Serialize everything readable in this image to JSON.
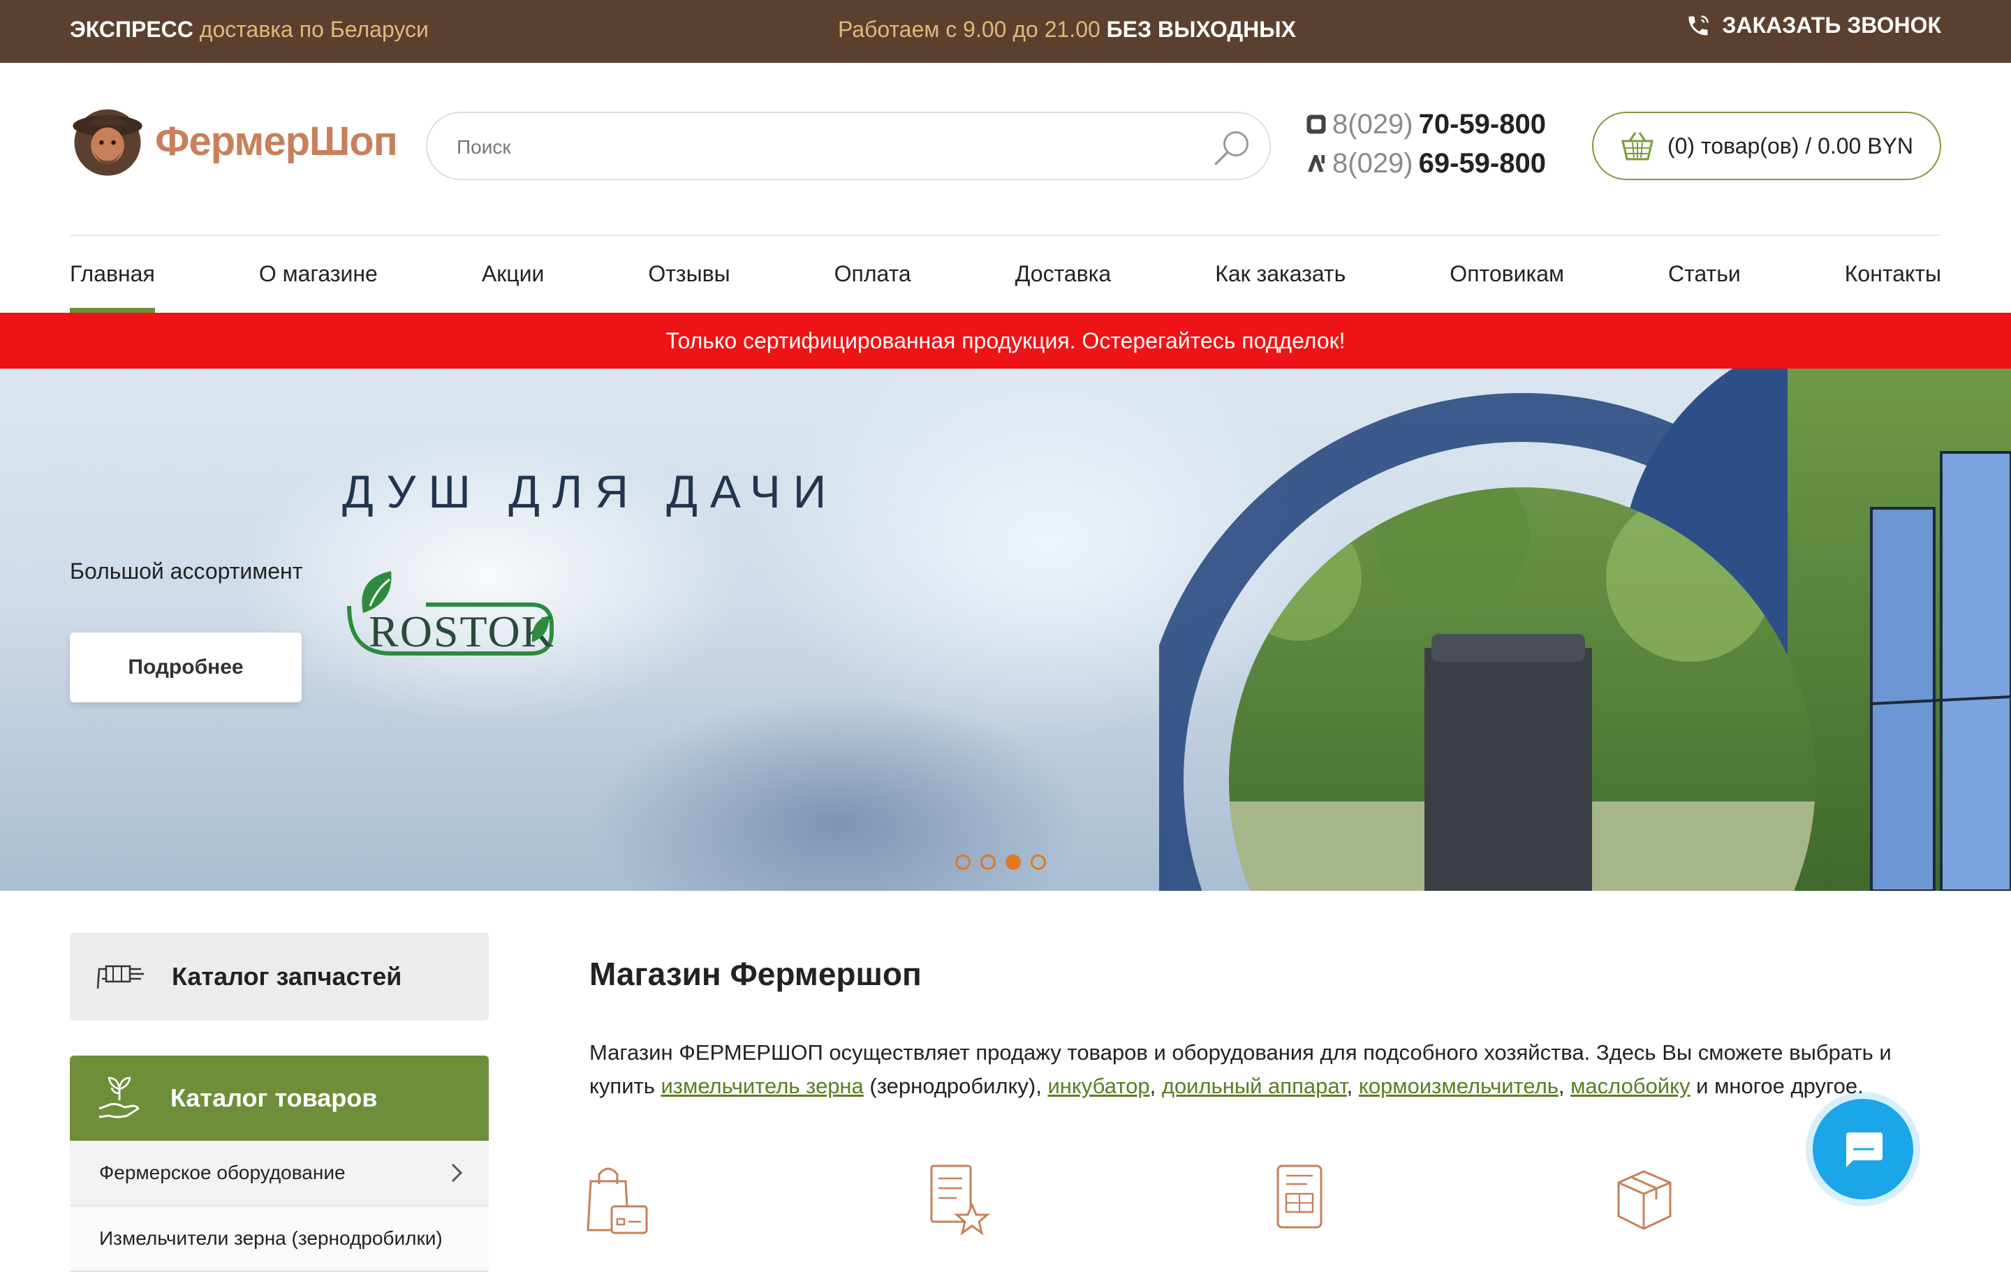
{
  "topbar": {
    "express_bold": "ЭКСПРЕСС",
    "express_rest": " доставка по Беларуси",
    "hours_text": "Работаем с 9.00 до 21.00 ",
    "hours_bold": "БЕЗ ВЫХОДНЫХ",
    "callback_label": "ЗАКАЗАТЬ ЗВОНОК"
  },
  "header": {
    "logo_text": "ФермерШоп",
    "search_placeholder": "Поиск",
    "phones": [
      {
        "code": "8(029)",
        "number": "70-59-800",
        "operator_icon": "a1-icon"
      },
      {
        "code": "8(029)",
        "number": "69-59-800",
        "operator_icon": "a1-alt-icon"
      }
    ],
    "cart_label": "(0) товар(ов) / 0.00 BYN"
  },
  "nav": {
    "items": [
      "Главная",
      "О магазине",
      "Акции",
      "Отзывы",
      "Оплата",
      "Доставка",
      "Как заказать",
      "Оптовикам",
      "Статьи",
      "Контакты"
    ],
    "active_index": 0
  },
  "notice": "Только сертифицированная продукция. Остерегайтесь подделок!",
  "banner": {
    "title": "ДУШ ДЛЯ ДАЧИ",
    "subtitle": "Большой ассортимент",
    "brand": "ROSTOK",
    "button_label": "Подробнее",
    "slides_count": 4,
    "active_slide": 2
  },
  "sidebar": {
    "parts_catalog": "Каталог запчастей",
    "goods_catalog": "Каталог товаров",
    "items": [
      "Фермерское оборудование",
      "Измельчители зерна (зернодробилки)"
    ]
  },
  "main": {
    "title": "Магазин Фермершоп",
    "intro_1": "Магазин ФЕРМЕРШОП осуществляет продажу товаров и оборудования для подсобного хозяйства. Здесь Вы сможете выбрать и купить ",
    "link_1": "измельчитель зерна",
    "between_1": " (зернодробилку), ",
    "link_2": "инкубатор",
    "comma_1": ", ",
    "link_3": "доильный аппарат",
    "comma_2": ", ",
    "link_4": "кормоизмельчитель",
    "comma_3": ", ",
    "link_5": "маслобойку",
    "outro": " и многое другое."
  },
  "colors": {
    "topbar_bg": "#5b4030",
    "accent_green": "#6e8e3a",
    "notice_red": "#ee1316",
    "dot_orange": "#e07a20",
    "chat_blue": "#1aa6e8"
  }
}
